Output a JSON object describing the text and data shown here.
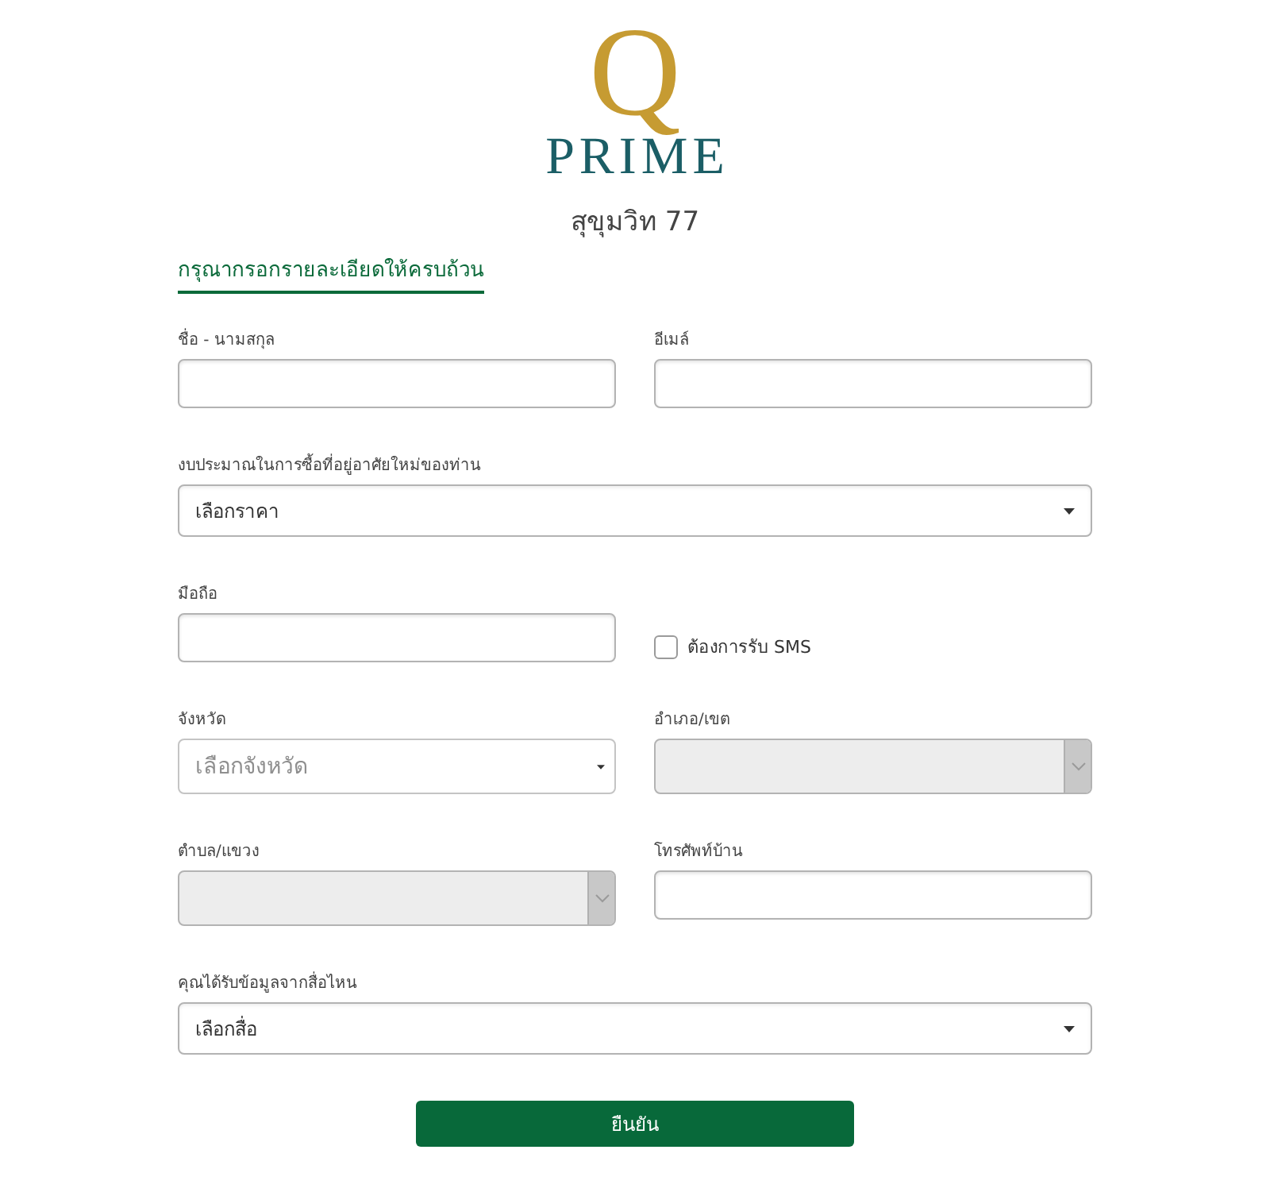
{
  "logo": {
    "mark": "Q",
    "name": "PRIME"
  },
  "subtitle": "สุขุมวิท 77",
  "heading": "กรุณากรอกรายละเอียดให้ครบถ้วน",
  "rows": [
    {
      "fields": [
        {
          "kind": "text",
          "label": "ชื่อ - นามสกุล"
        },
        {
          "kind": "text",
          "label": "อีเมล์"
        }
      ]
    },
    {
      "fields": [
        {
          "kind": "select",
          "label": "งบประมาณในการซื้อที่อยู่อาศัยใหม่ของท่าน",
          "value": "เลือกราคา",
          "disabled": false
        }
      ]
    },
    {
      "fields": [
        {
          "kind": "text",
          "label": "มือถือ"
        },
        {
          "kind": "checkbox",
          "label": "ต้องการรับ SMS",
          "checked": false
        }
      ]
    },
    {
      "fields": [
        {
          "kind": "select",
          "label": "จังหวัด",
          "placeholder": "เลือกจังหวัด",
          "disabled": false
        },
        {
          "kind": "select",
          "label": "อำเภอ/เขต",
          "disabled": true
        }
      ]
    },
    {
      "fields": [
        {
          "kind": "select",
          "label": "ตำบล/แขวง",
          "disabled": true
        },
        {
          "kind": "text",
          "label": "โทรศัพท์บ้าน"
        }
      ]
    },
    {
      "fields": [
        {
          "kind": "select",
          "label": "คุณได้รับข้อมูลจากสื่อไหน",
          "value": "เลือกสื่อ",
          "disabled": false
        }
      ]
    }
  ],
  "submit": {
    "label": "ยืนยัน"
  }
}
